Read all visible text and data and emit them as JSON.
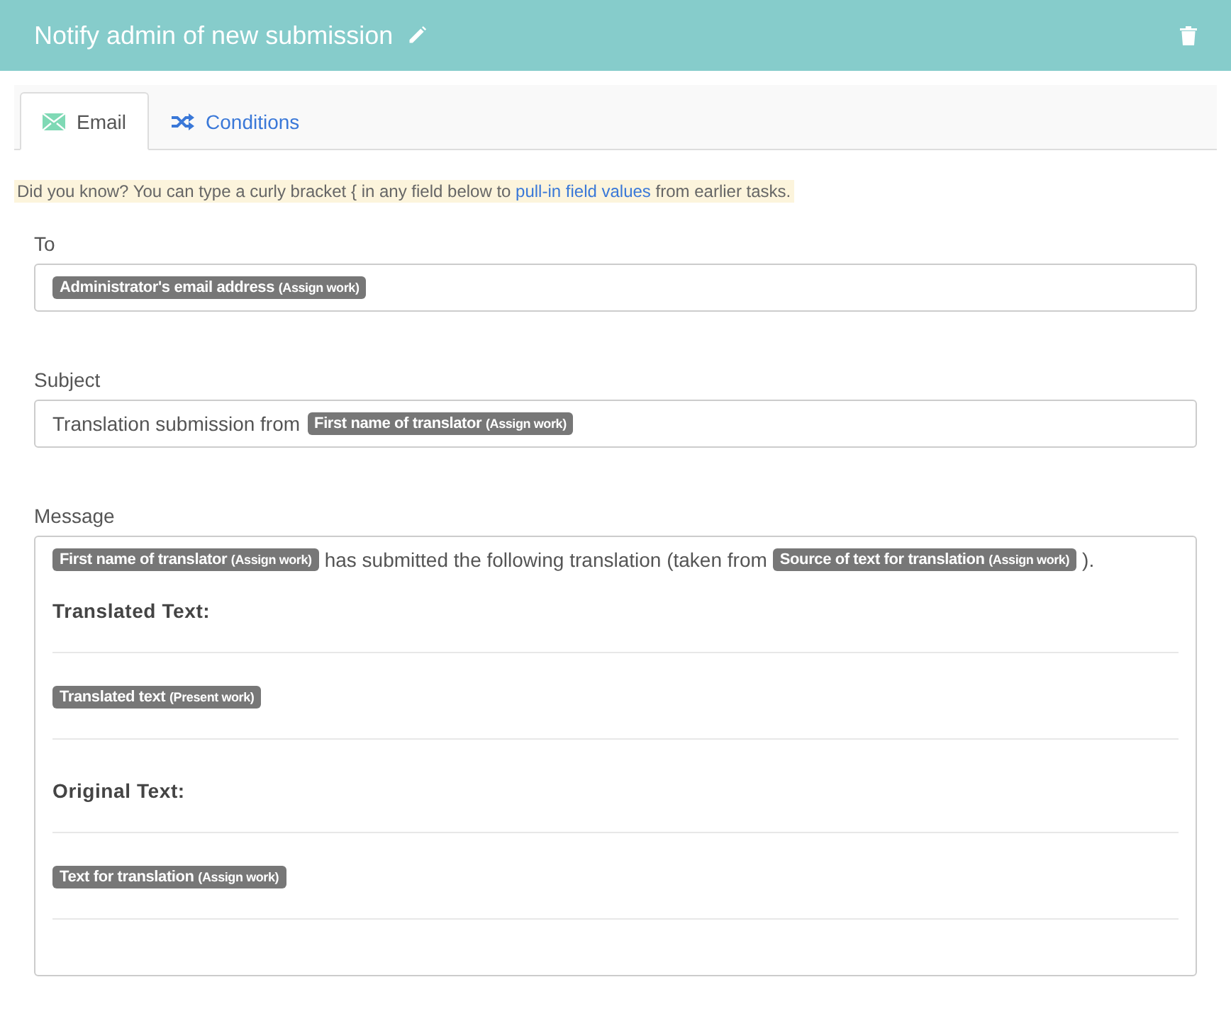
{
  "header": {
    "title": "Notify admin of new submission"
  },
  "tabs": [
    {
      "label": "Email",
      "kind": "email",
      "selected": true
    },
    {
      "label": "Conditions",
      "kind": "conditions",
      "selected": false
    }
  ],
  "tip": {
    "before": "Did you know? You can type a curly bracket { in any field below to",
    "link": "pull-in field values",
    "after": "from earlier tasks."
  },
  "fields": [
    {
      "label": "To",
      "parts": [
        {
          "kind": "token",
          "name": "Administrator's email address",
          "source": "(Assign work)"
        }
      ]
    },
    {
      "label": "Subject",
      "parts": [
        {
          "kind": "text",
          "text": "Translation submission from"
        },
        {
          "kind": "token",
          "name": "First name of translator",
          "source": "(Assign work)"
        }
      ]
    }
  ],
  "message": {
    "label": "Message",
    "blocks": [
      {
        "kind": "line",
        "parts": [
          {
            "kind": "token",
            "name": "First name of translator",
            "source": "(Assign work)"
          },
          {
            "kind": "text",
            "text": "has submitted the following translation (taken from"
          },
          {
            "kind": "token",
            "name": "Source of text for translation",
            "source": "(Assign work)"
          },
          {
            "kind": "text",
            "text": ")."
          }
        ]
      },
      {
        "kind": "heading",
        "text": "Translated Text:"
      },
      {
        "kind": "rule"
      },
      {
        "kind": "line",
        "parts": [
          {
            "kind": "token",
            "name": "Translated text",
            "source": "(Present work)"
          }
        ]
      },
      {
        "kind": "rule"
      },
      {
        "kind": "heading",
        "text": "Original Text:"
      },
      {
        "kind": "rule"
      },
      {
        "kind": "line",
        "parts": [
          {
            "kind": "token",
            "name": "Text for translation",
            "source": "(Assign work)"
          }
        ]
      },
      {
        "kind": "rule"
      }
    ]
  }
}
